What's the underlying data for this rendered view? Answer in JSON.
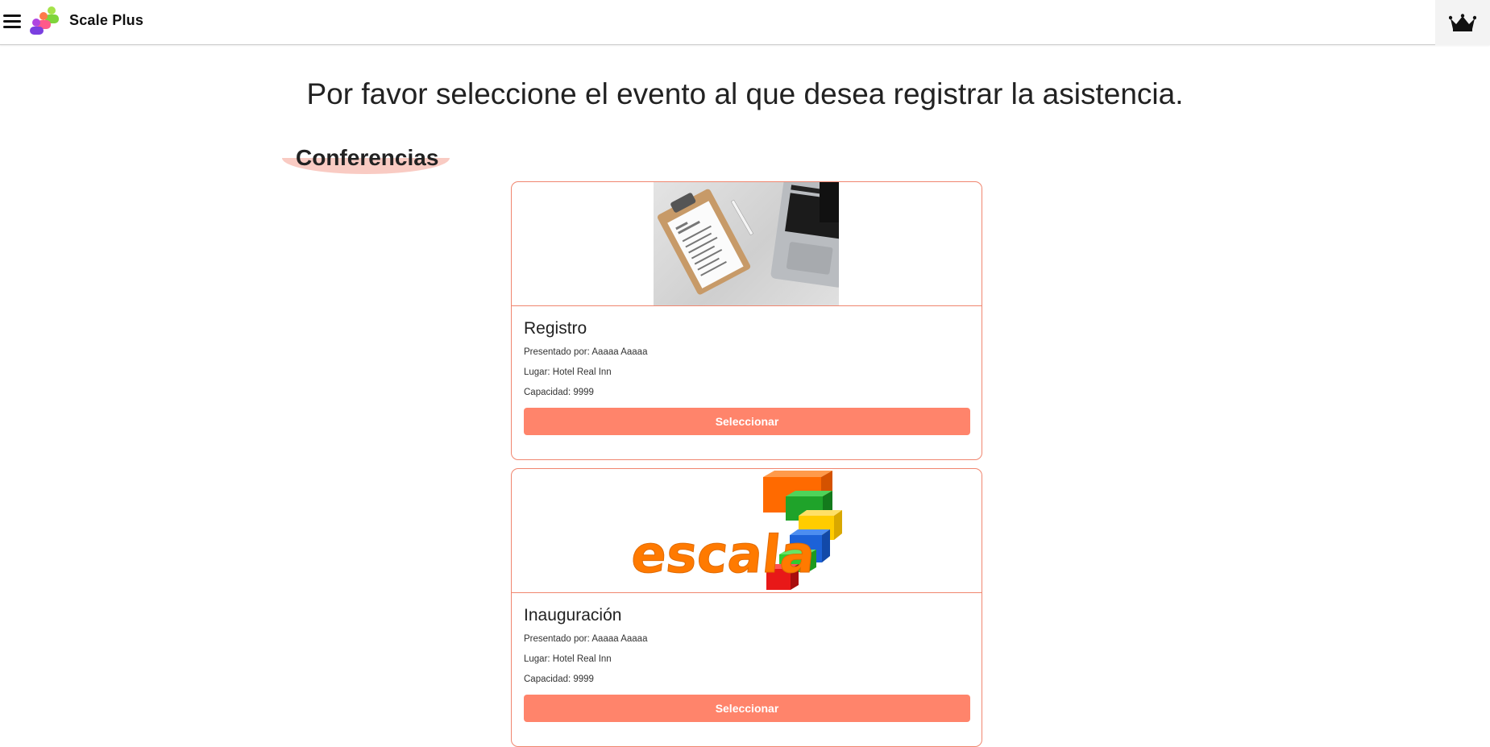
{
  "app": {
    "brand": "Scale Plus"
  },
  "colors": {
    "accent": "#ff846b",
    "card_border": "#f0866f",
    "section_highlight": "#f9cbc3"
  },
  "icons": {
    "menu": "hamburger-icon",
    "logo": "people-logo",
    "premium": "crown-icon"
  },
  "page": {
    "heading": "Por favor seleccione el evento al que desea registrar la asistencia."
  },
  "section": {
    "title": "Conferencias"
  },
  "events": [
    {
      "title": "Registro",
      "presenter": "Presentado por: Aaaaa Aaaaa",
      "place": "Lugar: Hotel Real Inn",
      "capacity": "Capacidad: 9999",
      "button": "Seleccionar",
      "image": "clipboard-checklist-and-laptop-photo"
    },
    {
      "title": "Inauguración",
      "presenter": "Presentado por: Aaaaa Aaaaa",
      "place": "Lugar: Hotel Real Inn",
      "capacity": "Capacidad: 9999",
      "button": "Seleccionar",
      "image": "escala-logo-with-colored-cubes",
      "image_text": "escala"
    }
  ]
}
